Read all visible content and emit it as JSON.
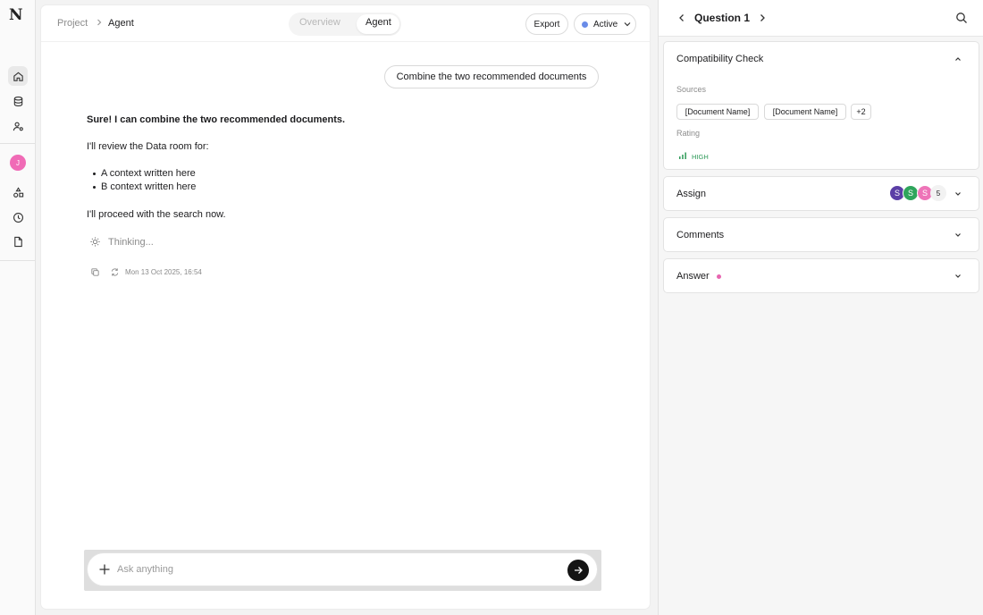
{
  "app": {
    "logo": "N"
  },
  "rail": {
    "avatar_initial": "J"
  },
  "header": {
    "breadcrumb": [
      "Project",
      "Agent"
    ],
    "tabs": [
      {
        "label": "Overview",
        "active": false
      },
      {
        "label": "Agent",
        "active": true
      }
    ],
    "export_label": "Export",
    "status_label": "Active",
    "status_color": "#6a8ce8"
  },
  "chat": {
    "user_message": "Combine the two recommended documents",
    "assistant": {
      "title": "Sure! I can combine the two recommended documents.",
      "intro": "I'll review the Data room for:",
      "bullets": [
        "A context written here",
        "B context written here"
      ],
      "outro": "I'll proceed with the search now.",
      "thinking": "Thinking...",
      "timestamp": "Mon 13 Oct 2025, 16:54"
    }
  },
  "composer": {
    "placeholder": "Ask anything",
    "value": ""
  },
  "panel": {
    "title": "Question 1",
    "compatibility": {
      "title": "Compatibility Check",
      "sources_label": "Sources",
      "sources": [
        "[Document Name]",
        "[Document Name]"
      ],
      "more": "+2",
      "rating_label": "Rating",
      "rating_value": "HIGH",
      "rating_color": "#2e9a58"
    },
    "assign": {
      "title": "Assign",
      "avatars": [
        {
          "initial": "S",
          "color": "#5b3fa6"
        },
        {
          "initial": "S",
          "color": "#2fa55c"
        },
        {
          "initial": "S",
          "color": "#ee74b8"
        }
      ],
      "count": "5"
    },
    "comments": {
      "title": "Comments"
    },
    "answer": {
      "title": "Answer",
      "dot_color": "#e765b0"
    }
  }
}
